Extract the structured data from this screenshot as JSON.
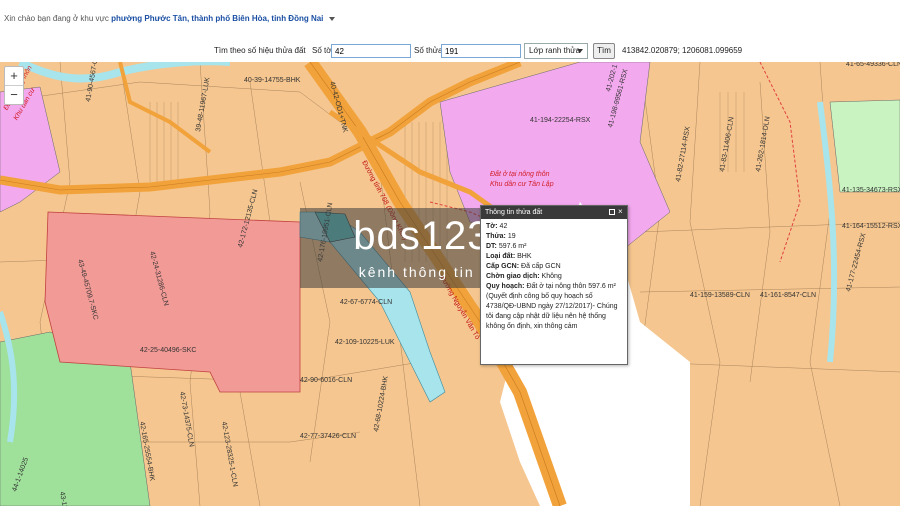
{
  "header": {
    "greeting": "Xin chào bạn đang ở khu vực",
    "location": "phường Phước Tân, thành phố Biên Hòa, tỉnh Đồng Nai"
  },
  "search": {
    "mode_label": "Tìm theo số hiệu thửa đất",
    "sheet_label": "Số tờ:",
    "sheet_value": "42",
    "parcel_label": "Số thửa:",
    "parcel_value": "191",
    "layer_select": "Lớp ranh thửa",
    "search_button": "Tìm",
    "coordinates": "413842.020879; 1206081.099659"
  },
  "zoom": {
    "in": "+",
    "out": "−"
  },
  "popup": {
    "title": "Thông tin thửa đất",
    "sheet_label": "Tờ:",
    "sheet_value": "42",
    "parcel_label": "Thửa:",
    "parcel_value": "19",
    "area_label": "DT:",
    "area_value": "597.6 m²",
    "landtype_label": "Loại đất:",
    "landtype_value": "BHK",
    "cert_label": "Cấp GCN:",
    "cert_value": "Đã cấp GCN",
    "trans_label": "Chờn giao dịch:",
    "trans_value": "Không",
    "plan_label": "Quy hoạch:",
    "plan_value": "Đất ở tại nông thôn 597.6 m²",
    "note": "(Quyết định công bố quy hoạch số 4738/QĐ-UBND ngày 27/12/2017)- Chúng tôi đang cập nhật dữ liệu nên hệ thống không ổn định, xin thông cảm"
  },
  "watermark": {
    "brand": "bds123.vn",
    "tagline": "kênh thông tin nhà đất"
  },
  "map_labels": {
    "zone_rural": "Đất ở tại nông thôn",
    "zone_residential": "Khu dân cư Tân Lập",
    "zone_left_1": "Đất ở nông thôn",
    "zone_left_2": "Khu dân cư",
    "road_1": "Đường tỉnh 768 (Đồng Khởi)",
    "road_2": "Đường Nguyễn Văn Tỏ",
    "parcels": [
      "42-25-40496-SKC",
      "43-49-45709.7-SKC",
      "42-24-31286-CLN",
      "42-172-12135-CLN",
      "42-176-19951-CLN",
      "42-67-6774-CLN",
      "42-109-10225-LUK",
      "42-90-6016-CLN",
      "42-77-37426-CLN",
      "42-123-28325-1-CLN",
      "42-73-14375-CLN",
      "42-165-25554-BHK",
      "42-68-10224-BHK",
      "41-194-22254-RSX",
      "41-198-99561-RSX",
      "41-202-1",
      "41-82-27114-RSX",
      "41-83-11406-CLN",
      "41-262-1814-DLN",
      "41-135-34673-RSX",
      "41-164-15512-RSX",
      "41-159-13589-CLN",
      "41-161-8547-CLN",
      "41-177-22454-RSX",
      "40-39-14755-BHK",
      "39-48-11967-LUK",
      "41-65-49336-CLN",
      "44-1-14025",
      "43-13-4",
      "41-90-4567-CLN",
      "40-42-OD1+TNK"
    ]
  },
  "colors": {
    "land_orange": "#f5c68f",
    "residential_pink": "#f3a9ee",
    "industrial_red": "#f29a96",
    "green": "#9fe09a",
    "river": "#a8e4ec",
    "road_orange": "#f2a23a"
  }
}
